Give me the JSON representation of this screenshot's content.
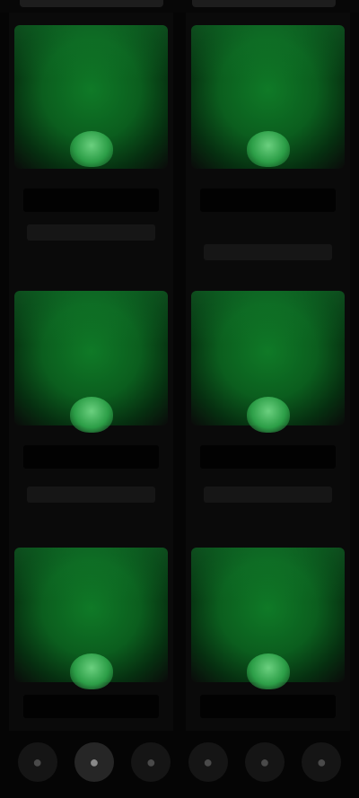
{
  "grid": {
    "cards": [
      {
        "logo": "",
        "title": "",
        "subtitle": ""
      },
      {
        "logo": "",
        "title": "",
        "subtitle": ""
      },
      {
        "logo": "",
        "title": "",
        "subtitle": ""
      },
      {
        "logo": "",
        "title": "",
        "subtitle": ""
      },
      {
        "logo": "",
        "title": "",
        "subtitle": ""
      },
      {
        "logo": "",
        "title": "",
        "subtitle": ""
      }
    ]
  },
  "bottom_nav": {
    "items": [
      {
        "icon": "●"
      },
      {
        "icon": "●"
      },
      {
        "icon": "●"
      },
      {
        "icon": "●"
      },
      {
        "icon": "●"
      },
      {
        "icon": "●"
      }
    ],
    "active_index": 1
  },
  "colors": {
    "background": "#050505",
    "card_green": "#0b5e1e",
    "card_green_light": "#2c9e47",
    "placeholder_text": "#161616"
  }
}
